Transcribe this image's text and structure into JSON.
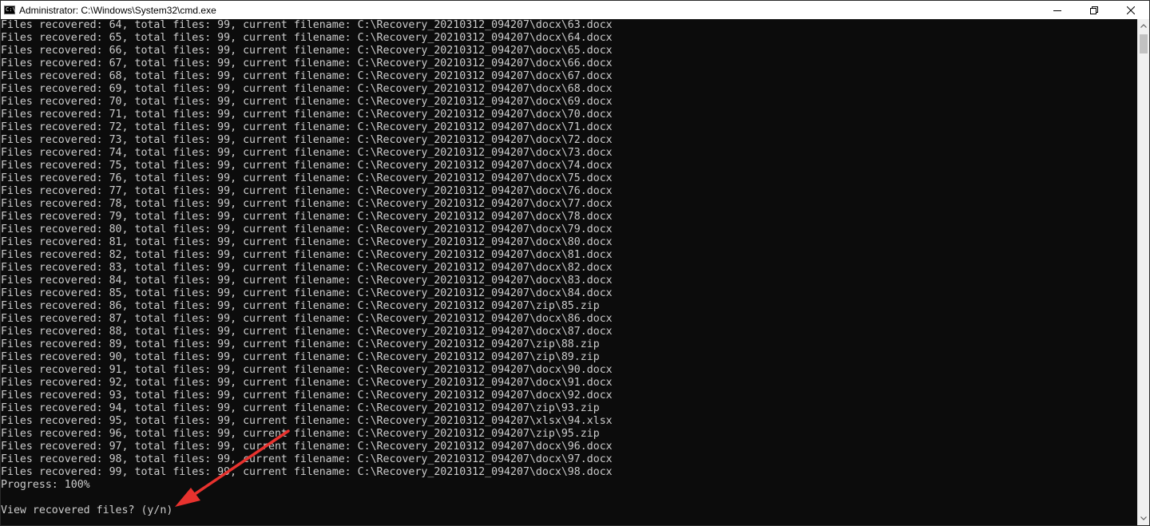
{
  "window": {
    "title": "Administrator: C:\\Windows\\System32\\cmd.exe",
    "icon": "cmd-console-icon",
    "icon_glyph": "C:\\",
    "controls": [
      "minimize-icon",
      "maximize-icon",
      "close-icon"
    ]
  },
  "console": {
    "text_color": "#cccccc",
    "background": "#0c0c0c",
    "lines": [
      "Files recovered: 64, total files: 99, current filename: C:\\Recovery_20210312_094207\\docx\\63.docx",
      "Files recovered: 65, total files: 99, current filename: C:\\Recovery_20210312_094207\\docx\\64.docx",
      "Files recovered: 66, total files: 99, current filename: C:\\Recovery_20210312_094207\\docx\\65.docx",
      "Files recovered: 67, total files: 99, current filename: C:\\Recovery_20210312_094207\\docx\\66.docx",
      "Files recovered: 68, total files: 99, current filename: C:\\Recovery_20210312_094207\\docx\\67.docx",
      "Files recovered: 69, total files: 99, current filename: C:\\Recovery_20210312_094207\\docx\\68.docx",
      "Files recovered: 70, total files: 99, current filename: C:\\Recovery_20210312_094207\\docx\\69.docx",
      "Files recovered: 71, total files: 99, current filename: C:\\Recovery_20210312_094207\\docx\\70.docx",
      "Files recovered: 72, total files: 99, current filename: C:\\Recovery_20210312_094207\\docx\\71.docx",
      "Files recovered: 73, total files: 99, current filename: C:\\Recovery_20210312_094207\\docx\\72.docx",
      "Files recovered: 74, total files: 99, current filename: C:\\Recovery_20210312_094207\\docx\\73.docx",
      "Files recovered: 75, total files: 99, current filename: C:\\Recovery_20210312_094207\\docx\\74.docx",
      "Files recovered: 76, total files: 99, current filename: C:\\Recovery_20210312_094207\\docx\\75.docx",
      "Files recovered: 77, total files: 99, current filename: C:\\Recovery_20210312_094207\\docx\\76.docx",
      "Files recovered: 78, total files: 99, current filename: C:\\Recovery_20210312_094207\\docx\\77.docx",
      "Files recovered: 79, total files: 99, current filename: C:\\Recovery_20210312_094207\\docx\\78.docx",
      "Files recovered: 80, total files: 99, current filename: C:\\Recovery_20210312_094207\\docx\\79.docx",
      "Files recovered: 81, total files: 99, current filename: C:\\Recovery_20210312_094207\\docx\\80.docx",
      "Files recovered: 82, total files: 99, current filename: C:\\Recovery_20210312_094207\\docx\\81.docx",
      "Files recovered: 83, total files: 99, current filename: C:\\Recovery_20210312_094207\\docx\\82.docx",
      "Files recovered: 84, total files: 99, current filename: C:\\Recovery_20210312_094207\\docx\\83.docx",
      "Files recovered: 85, total files: 99, current filename: C:\\Recovery_20210312_094207\\docx\\84.docx",
      "Files recovered: 86, total files: 99, current filename: C:\\Recovery_20210312_094207\\zip\\85.zip",
      "Files recovered: 87, total files: 99, current filename: C:\\Recovery_20210312_094207\\docx\\86.docx",
      "Files recovered: 88, total files: 99, current filename: C:\\Recovery_20210312_094207\\docx\\87.docx",
      "Files recovered: 89, total files: 99, current filename: C:\\Recovery_20210312_094207\\zip\\88.zip",
      "Files recovered: 90, total files: 99, current filename: C:\\Recovery_20210312_094207\\zip\\89.zip",
      "Files recovered: 91, total files: 99, current filename: C:\\Recovery_20210312_094207\\docx\\90.docx",
      "Files recovered: 92, total files: 99, current filename: C:\\Recovery_20210312_094207\\docx\\91.docx",
      "Files recovered: 93, total files: 99, current filename: C:\\Recovery_20210312_094207\\docx\\92.docx",
      "Files recovered: 94, total files: 99, current filename: C:\\Recovery_20210312_094207\\zip\\93.zip",
      "Files recovered: 95, total files: 99, current filename: C:\\Recovery_20210312_094207\\xlsx\\94.xlsx",
      "Files recovered: 96, total files: 99, current filename: C:\\Recovery_20210312_094207\\zip\\95.zip",
      "Files recovered: 97, total files: 99, current filename: C:\\Recovery_20210312_094207\\docx\\96.docx",
      "Files recovered: 98, total files: 99, current filename: C:\\Recovery_20210312_094207\\docx\\97.docx",
      "Files recovered: 99, total files: 99, current filename: C:\\Recovery_20210312_094207\\docx\\98.docx",
      "Progress: 100%",
      "",
      "View recovered files? (y/n)"
    ]
  },
  "annotation": {
    "type": "arrow",
    "color": "#e8322e",
    "points_to": "View recovered files? (y/n)"
  },
  "scrollbar": {
    "icons": [
      "scroll-up-icon",
      "scroll-down-icon"
    ]
  }
}
